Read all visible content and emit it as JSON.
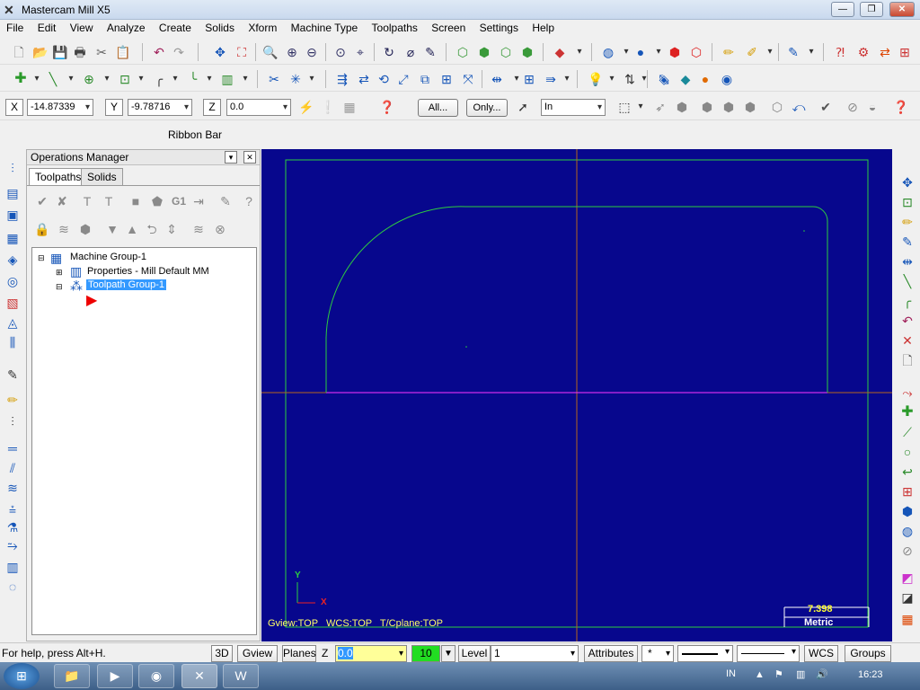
{
  "window": {
    "title": "Mastercam Mill X5",
    "app_icon": "mastercam-x-icon"
  },
  "menu": [
    "File",
    "Edit",
    "View",
    "Analyze",
    "Create",
    "Solids",
    "Xform",
    "Machine Type",
    "Toolpaths",
    "Screen",
    "Settings",
    "Help"
  ],
  "ribbon": {
    "x_label": "X",
    "x_value": "-14.87339",
    "y_label": "Y",
    "y_value": "-9.78716",
    "z_label": "Z",
    "z_value": "0.0",
    "all_label": "All...",
    "only_label": "Only...",
    "units_value": "In",
    "ribbon_bar_label": "Ribbon Bar"
  },
  "ops_manager": {
    "title": "Operations Manager",
    "tabs": [
      "Toolpaths",
      "Solids"
    ],
    "tree": {
      "machine_group": "Machine Group-1",
      "properties": "Properties - Mill Default MM",
      "toolpath_group": "Toolpath Group-1"
    }
  },
  "viewport": {
    "background": "#07078d",
    "axis_y": "Y",
    "axis_x": "X",
    "view_info": "Gview:TOP   WCS:TOP   T/Cplane:TOP",
    "scale_value": "7.398",
    "scale_units": "Metric"
  },
  "statusbar": {
    "help_text": "For help, press Alt+H.",
    "btn_3d": "3D",
    "btn_gview": "Gview",
    "btn_planes": "Planes",
    "z_label": "Z",
    "z_value": "0.0",
    "color_value": "10",
    "level_label": "Level",
    "level_value": "1",
    "attributes": "Attributes",
    "point_style": "*",
    "wcs": "WCS",
    "groups": "Groups"
  },
  "taskbar": {
    "lang": "IN",
    "time": "16:23"
  }
}
